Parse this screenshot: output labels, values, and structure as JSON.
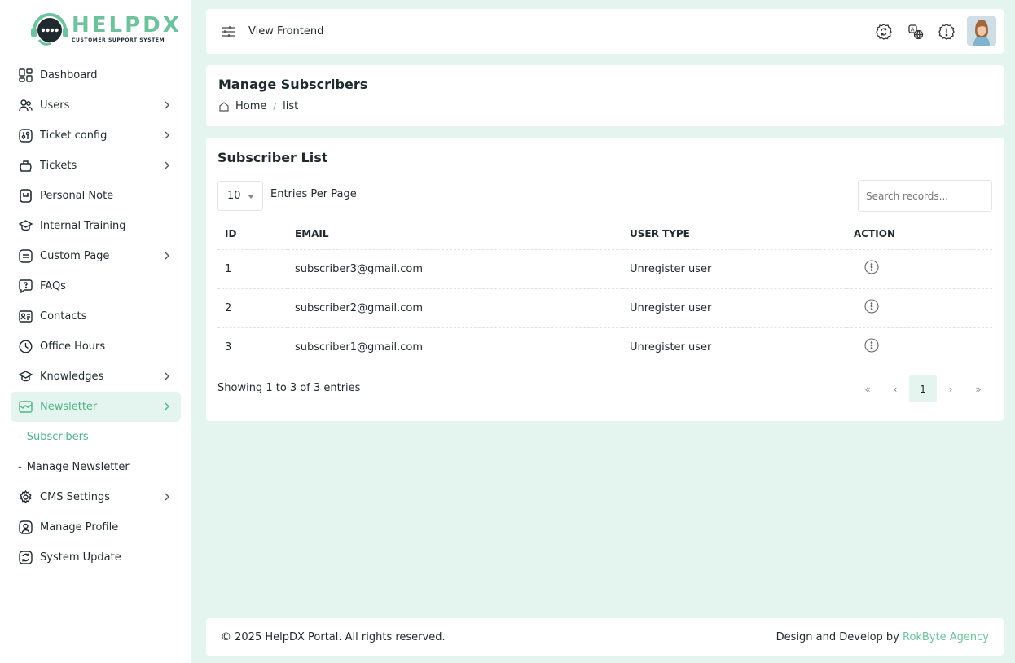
{
  "brand": {
    "name": "HELPDX",
    "tagline": "CUSTOMER SUPPORT SYSTEM",
    "accent": "#6ec29e"
  },
  "sidebar": {
    "items": [
      {
        "label": "Dashboard",
        "icon": "dashboard-icon",
        "has_submenu": false
      },
      {
        "label": "Users",
        "icon": "users-icon",
        "has_submenu": true
      },
      {
        "label": "Ticket config",
        "icon": "ticket-config-icon",
        "has_submenu": true
      },
      {
        "label": "Tickets",
        "icon": "tickets-icon",
        "has_submenu": true
      },
      {
        "label": "Personal Note",
        "icon": "note-icon",
        "has_submenu": false
      },
      {
        "label": "Internal Training",
        "icon": "graduation-cap-icon",
        "has_submenu": false
      },
      {
        "label": "Custom Page",
        "icon": "page-icon",
        "has_submenu": true
      },
      {
        "label": "FAQs",
        "icon": "faq-icon",
        "has_submenu": false
      },
      {
        "label": "Contacts",
        "icon": "contact-card-icon",
        "has_submenu": false
      },
      {
        "label": "Office Hours",
        "icon": "clock-icon",
        "has_submenu": false
      },
      {
        "label": "Knowledges",
        "icon": "knowledge-icon",
        "has_submenu": true
      },
      {
        "label": "Newsletter",
        "icon": "newsletter-icon",
        "has_submenu": true,
        "active": true
      },
      {
        "label": "CMS Settings",
        "icon": "gear-icon",
        "has_submenu": true
      },
      {
        "label": "Manage Profile",
        "icon": "profile-icon",
        "has_submenu": false
      },
      {
        "label": "System Update",
        "icon": "refresh-icon",
        "has_submenu": false
      }
    ],
    "newsletter_submenu": [
      {
        "label": "Subscribers",
        "active": true
      },
      {
        "label": "Manage Newsletter",
        "active": false
      }
    ]
  },
  "header": {
    "view_frontend": "View Frontend",
    "icons": [
      "sync-icon",
      "language-icon",
      "alert-icon"
    ]
  },
  "page": {
    "title": "Manage Subscribers",
    "breadcrumb": {
      "home": "Home",
      "current": "list"
    }
  },
  "subscribers": {
    "title": "Subscriber List",
    "per_page": "10",
    "per_page_label": "Entries Per Page",
    "search_placeholder": "Search records...",
    "columns": [
      "ID",
      "EMAIL",
      "USER TYPE",
      "ACTION"
    ],
    "rows": [
      {
        "id": "1",
        "email": "subscriber3@gmail.com",
        "user_type": "Unregister user"
      },
      {
        "id": "2",
        "email": "subscriber2@gmail.com",
        "user_type": "Unregister user"
      },
      {
        "id": "3",
        "email": "subscriber1@gmail.com",
        "user_type": "Unregister user"
      }
    ],
    "showing": "Showing 1 to 3 of 3 entries",
    "pagination": {
      "first": "«",
      "prev": "‹",
      "current": "1",
      "next": "›",
      "last": "»"
    }
  },
  "footer": {
    "copyright": "© 2025 HelpDX Portal. All rights reserved.",
    "credit_prefix": "Design and Develop by",
    "credit_link": "RokByte Agency"
  }
}
